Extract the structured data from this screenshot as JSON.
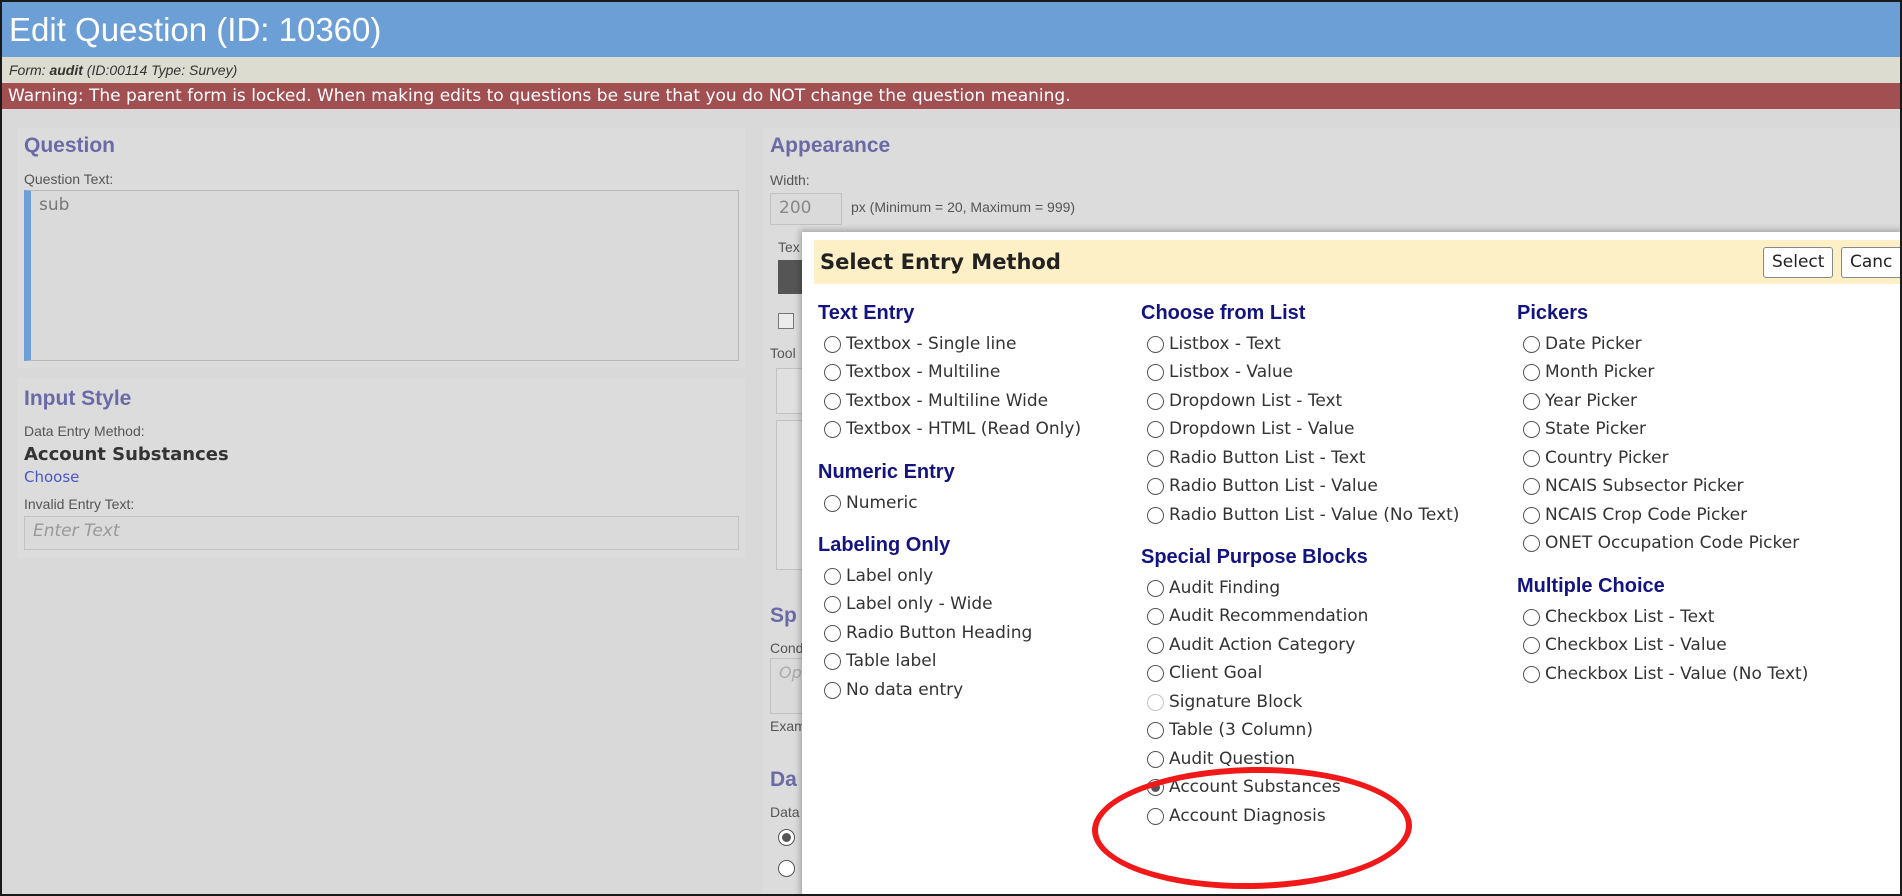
{
  "header": {
    "title": "Edit Question (ID: 10360)",
    "form_prefix": "Form: ",
    "form_name": "audit",
    "form_meta": " (ID:00114  Type: Survey)",
    "warning": "Warning: The parent form is locked. When making edits to questions be sure that you do NOT change the question meaning."
  },
  "question": {
    "section_title": "Question",
    "text_label": "Question Text:",
    "text_value": "sub"
  },
  "input_style": {
    "section_title": "Input Style",
    "method_label": "Data Entry Method:",
    "method_value": "Account Substances",
    "choose_link": "Choose",
    "invalid_label": "Invalid Entry Text:",
    "invalid_placeholder": "Enter Text"
  },
  "appearance": {
    "section_title": "Appearance",
    "width_label": "Width:",
    "width_value": "200",
    "width_hint": "px (Minimum = 20, Maximum = 999)",
    "partial_tex": "Tex",
    "partial_tool": "Tool",
    "partial_sp": "Sp",
    "partial_cond": "Cond",
    "partial_op": "Op",
    "partial_exam": "Exam",
    "partial_da": "Da",
    "partial_data": "Data"
  },
  "modal": {
    "title": "Select Entry Method",
    "select_button": "Select",
    "cancel_button": "Canc",
    "groups": {
      "text_entry": {
        "title": "Text Entry",
        "options": [
          "Textbox - Single line",
          "Textbox - Multiline",
          "Textbox - Multiline Wide",
          "Textbox - HTML (Read Only)"
        ]
      },
      "numeric_entry": {
        "title": "Numeric Entry",
        "options": [
          "Numeric"
        ]
      },
      "labeling_only": {
        "title": "Labeling Only",
        "options": [
          "Label only",
          "Label only - Wide",
          "Radio Button Heading",
          "Table label",
          "No data entry"
        ]
      },
      "choose_from_list": {
        "title": "Choose from List",
        "options": [
          "Listbox - Text",
          "Listbox - Value",
          "Dropdown List - Text",
          "Dropdown List - Value",
          "Radio Button List - Text",
          "Radio Button List - Value",
          "Radio Button List - Value (No Text)"
        ]
      },
      "special_purpose": {
        "title": "Special Purpose Blocks",
        "options": [
          "Audit Finding",
          "Audit Recommendation",
          "Audit Action Category",
          "Client Goal",
          "Signature Block",
          "Table (3 Column)",
          "Audit Question",
          "Account Substances",
          "Account Diagnosis"
        ],
        "selected": "Account Substances",
        "disabled": "Signature Block"
      },
      "pickers": {
        "title": "Pickers",
        "options": [
          "Date Picker",
          "Month Picker",
          "Year Picker",
          "State Picker",
          "Country Picker",
          "NCAIS Subsector Picker",
          "NCAIS Crop Code Picker",
          "ONET Occupation Code Picker"
        ]
      },
      "multiple_choice": {
        "title": "Multiple Choice",
        "options": [
          "Checkbox List - Text",
          "Checkbox List - Value",
          "Checkbox List - Value (No Text)"
        ]
      }
    }
  },
  "colors": {
    "title_bar": "#6c9fd6",
    "warning_bar": "#a24f52",
    "section_title": "#6b6aa6",
    "group_title": "#141480",
    "modal_header": "#fdf0c6",
    "annotation": "#f01818"
  }
}
